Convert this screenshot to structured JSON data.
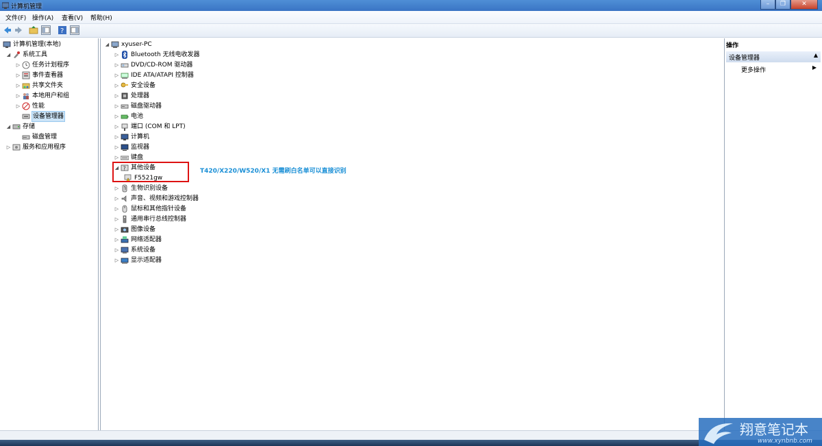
{
  "window": {
    "title": "计算机管理"
  },
  "menu": [
    "文件(F)",
    "操作(A)",
    "查看(V)",
    "帮助(H)"
  ],
  "left_tree": [
    {
      "label": "计算机管理(本地)",
      "level": 0,
      "arrow": "",
      "icon": "computer-management-icon"
    },
    {
      "label": "系统工具",
      "level": 1,
      "arrow": "◢",
      "icon": "system-tools-icon"
    },
    {
      "label": "任务计划程序",
      "level": 2,
      "arrow": "▷",
      "icon": "task-scheduler-icon"
    },
    {
      "label": "事件查看器",
      "level": 2,
      "arrow": "▷",
      "icon": "event-viewer-icon"
    },
    {
      "label": "共享文件夹",
      "level": 2,
      "arrow": "▷",
      "icon": "shared-folder-icon"
    },
    {
      "label": "本地用户和组",
      "level": 2,
      "arrow": "▷",
      "icon": "users-icon"
    },
    {
      "label": "性能",
      "level": 2,
      "arrow": "▷",
      "icon": "performance-icon"
    },
    {
      "label": "设备管理器",
      "level": 2,
      "arrow": "",
      "icon": "device-manager-icon",
      "selected": true
    },
    {
      "label": "存储",
      "level": 1,
      "arrow": "◢",
      "icon": "storage-icon"
    },
    {
      "label": "磁盘管理",
      "level": 2,
      "arrow": "",
      "icon": "disk-icon"
    },
    {
      "label": "服务和应用程序",
      "level": 1,
      "arrow": "▷",
      "icon": "services-icon"
    }
  ],
  "device_tree": {
    "root": "xyuser-PC",
    "items": [
      {
        "label": "Bluetooth 无线电收发器",
        "icon": "bluetooth-icon"
      },
      {
        "label": "DVD/CD-ROM 驱动器",
        "icon": "dvd-drive-icon"
      },
      {
        "label": "IDE ATA/ATAPI 控制器",
        "icon": "ide-controller-icon"
      },
      {
        "label": "安全设备",
        "icon": "security-key-icon"
      },
      {
        "label": "处理器",
        "icon": "processor-icon"
      },
      {
        "label": "磁盘驱动器",
        "icon": "disk-drive-icon"
      },
      {
        "label": "电池",
        "icon": "battery-icon"
      },
      {
        "label": "端口 (COM 和 LPT)",
        "icon": "port-icon"
      },
      {
        "label": "计算机",
        "icon": "computer-icon"
      },
      {
        "label": "监视器",
        "icon": "monitor-icon"
      },
      {
        "label": "键盘",
        "icon": "keyboard-icon"
      },
      {
        "label": "其他设备",
        "icon": "other-devices-icon",
        "expanded": true,
        "children": [
          {
            "label": "F5521gw",
            "icon": "unknown-device-warning-icon"
          }
        ]
      },
      {
        "label": "生物识别设备",
        "icon": "biometric-icon"
      },
      {
        "label": "声音、视频和游戏控制器",
        "icon": "sound-icon"
      },
      {
        "label": "鼠标和其他指针设备",
        "icon": "mouse-icon"
      },
      {
        "label": "通用串行总线控制器",
        "icon": "usb-icon"
      },
      {
        "label": "图像设备",
        "icon": "camera-icon"
      },
      {
        "label": "网络适配器",
        "icon": "network-adapter-icon"
      },
      {
        "label": "系统设备",
        "icon": "system-device-icon"
      },
      {
        "label": "显示适配器",
        "icon": "display-adapter-icon"
      }
    ]
  },
  "annotation": {
    "text": "T420/X220/W520/X1 无需刷白名单可以直接识别",
    "color": "#1a8fd6",
    "box_color": "#dd1111"
  },
  "actions": {
    "header": "操作",
    "section": "设备管理器",
    "more": "更多操作"
  },
  "watermark": {
    "title": "翔意笔记本",
    "url": "www.xynbnb.com"
  }
}
